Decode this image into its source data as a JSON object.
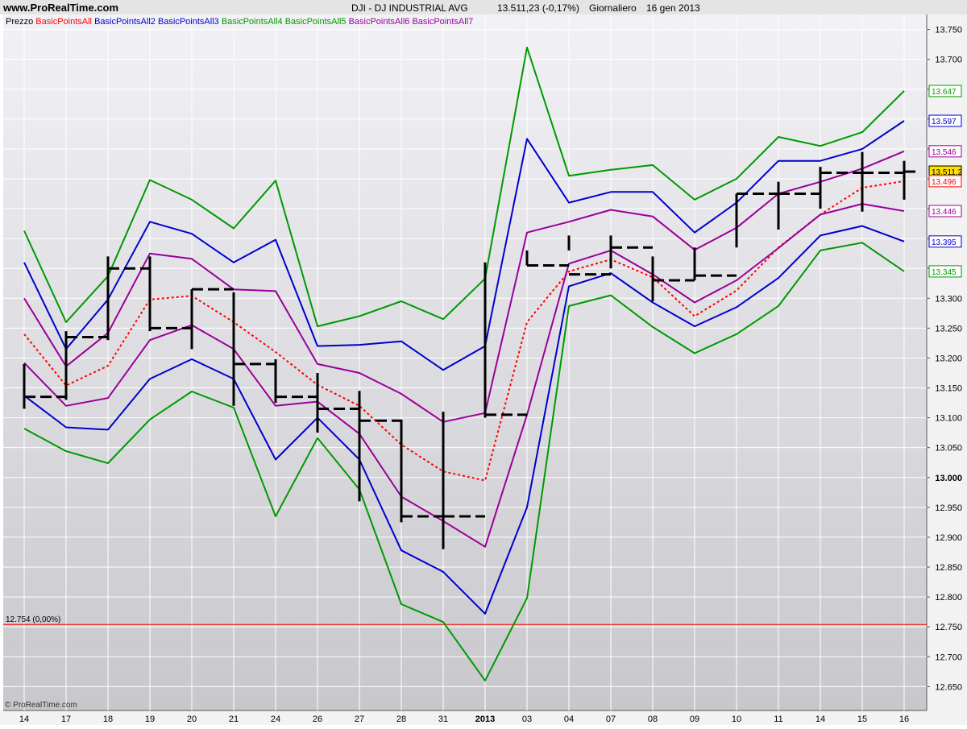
{
  "header": {
    "site": "www.ProRealTime.com",
    "instrument": "DJI - DJ INDUSTRIAL AVG",
    "last": "13.511,23 (-0,17%)",
    "period": "Giornaliero",
    "date": "16 gen 2013"
  },
  "legend": [
    {
      "label": "Prezzo",
      "color": "#000000"
    },
    {
      "label": "BasicPointsAll",
      "color": "#ff0000"
    },
    {
      "label": "BasicPointsAll2",
      "color": "#0000cc"
    },
    {
      "label": "BasicPointsAll3",
      "color": "#0000cc"
    },
    {
      "label": "BasicPointsAll4",
      "color": "#009900"
    },
    {
      "label": "BasicPointsAll5",
      "color": "#009900"
    },
    {
      "label": "BasicPointsAll6",
      "color": "#990099"
    },
    {
      "label": "BasicPointsAll7",
      "color": "#990099"
    }
  ],
  "copyright": "© ProRealTime.com",
  "h_line": {
    "value": 12754,
    "label": "12.754 (0,00%)",
    "color": "#ff0000"
  },
  "colors": {
    "price": "#000000",
    "red": "#ff0000",
    "blue": "#0000cc",
    "green": "#009900",
    "purple": "#990099",
    "last_badge": "#ffe000",
    "grid": "#ffffff"
  },
  "chart_data": {
    "type": "line",
    "title": "DJI - DJ INDUSTRIAL AVG",
    "x_labels": [
      "14",
      "17",
      "18",
      "19",
      "20",
      "21",
      "24",
      "26",
      "27",
      "28",
      "31",
      "2013",
      "03",
      "04",
      "07",
      "08",
      "09",
      "10",
      "11",
      "14",
      "15",
      "16"
    ],
    "ylim": [
      12610,
      13775
    ],
    "y_ticks": [
      12650,
      12700,
      12750,
      12800,
      12850,
      12900,
      12950,
      13000,
      13050,
      13100,
      13150,
      13200,
      13250,
      13300,
      13350,
      13400,
      13450,
      13500,
      13550,
      13600,
      13650,
      13700,
      13750
    ],
    "y_tick_labels": [
      "12.650",
      "12.700",
      "12.750",
      "12.800",
      "12.850",
      "12.900",
      "12.950",
      "13.000",
      "13.050",
      "13.100",
      "13.150",
      "13.200",
      "13.250",
      "13.300",
      "13.350",
      "13.400",
      "13.450",
      "13.500",
      "13.550",
      "13.600",
      "13.650",
      "13.700",
      "13.750"
    ],
    "y_bold_tick": "13.000",
    "grid": true,
    "price_bars": {
      "style": "hlc",
      "high": [
        13190,
        13245,
        13370,
        13370,
        13315,
        13310,
        13198,
        13175,
        13145,
        13097,
        13110,
        13360,
        13380,
        13405,
        13405,
        13370,
        13385,
        13475,
        13495,
        13520,
        13545,
        13530
      ],
      "low": [
        13115,
        13130,
        13230,
        13245,
        13215,
        13120,
        13125,
        13075,
        12960,
        12925,
        12880,
        13100,
        13355,
        13380,
        13350,
        13295,
        13330,
        13385,
        13415,
        13450,
        13445,
        13465
      ],
      "close": [
        13135,
        13235,
        13350,
        13250,
        13315,
        13190,
        13135,
        13115,
        13095,
        12935,
        12935,
        13105,
        13355,
        13340,
        13385,
        13330,
        13338,
        13475,
        13475,
        13510,
        13510,
        13512
      ]
    },
    "series": [
      {
        "name": "BasicPointsAll",
        "color": "#ff0000",
        "dash": true,
        "values": [
          13240,
          13154,
          13187,
          13298,
          13304,
          13260,
          13210,
          13155,
          13120,
          13055,
          13010,
          12995,
          13260,
          13345,
          13365,
          13335,
          13270,
          13313,
          13385,
          13440,
          13485,
          13496
        ]
      },
      {
        "name": "BasicPointsAll2",
        "color": "#0000cc",
        "values": [
          13360,
          13215,
          13298,
          13428,
          13408,
          13360,
          13398,
          13220,
          13222,
          13228,
          13180,
          13220,
          13567,
          13460,
          13478,
          13478,
          13410,
          13460,
          13530,
          13530,
          13550,
          13597
        ]
      },
      {
        "name": "BasicPointsAll3",
        "color": "#0000cc",
        "values": [
          13137,
          13084,
          13080,
          13165,
          13198,
          13165,
          13030,
          13100,
          13030,
          12878,
          12842,
          12772,
          12950,
          13320,
          13342,
          13293,
          13253,
          13285,
          13334,
          13405,
          13421,
          13395
        ]
      },
      {
        "name": "BasicPointsAll4",
        "color": "#009900",
        "values": [
          13413,
          13260,
          13337,
          13498,
          13465,
          13417,
          13497,
          13253,
          13270,
          13295,
          13265,
          13333,
          13720,
          13505,
          13515,
          13523,
          13465,
          13500,
          13570,
          13555,
          13578,
          13647
        ]
      },
      {
        "name": "BasicPointsAll5",
        "color": "#009900",
        "values": [
          13082,
          13044,
          13024,
          13097,
          13144,
          13117,
          12935,
          13066,
          12980,
          12788,
          12758,
          12660,
          12798,
          13287,
          13305,
          13252,
          13208,
          13240,
          13287,
          13380,
          13393,
          13345
        ]
      },
      {
        "name": "BasicPointsAll6",
        "color": "#990099",
        "values": [
          13300,
          13186,
          13242,
          13375,
          13366,
          13315,
          13312,
          13190,
          13175,
          13140,
          13093,
          13108,
          13410,
          13428,
          13448,
          13437,
          13381,
          13418,
          13475,
          13495,
          13517,
          13546
        ]
      },
      {
        "name": "BasicPointsAll7",
        "color": "#990099",
        "values": [
          13192,
          13120,
          13133,
          13230,
          13255,
          13215,
          13120,
          13127,
          13073,
          12968,
          12927,
          12884,
          13105,
          13358,
          13380,
          13340,
          13293,
          13330,
          13384,
          13440,
          13458,
          13446
        ]
      }
    ],
    "right_labels": [
      {
        "text": "13.647",
        "color": "#009900"
      },
      {
        "text": "13.597",
        "color": "#0000cc"
      },
      {
        "text": "13.546",
        "color": "#990099"
      },
      {
        "text": "13.511,2",
        "color": "#000000",
        "badge": true
      },
      {
        "text": "13.496",
        "color": "#ff0000"
      },
      {
        "text": "13.446",
        "color": "#990099"
      },
      {
        "text": "13.395",
        "color": "#0000cc"
      },
      {
        "text": "13.345",
        "color": "#009900"
      }
    ]
  }
}
